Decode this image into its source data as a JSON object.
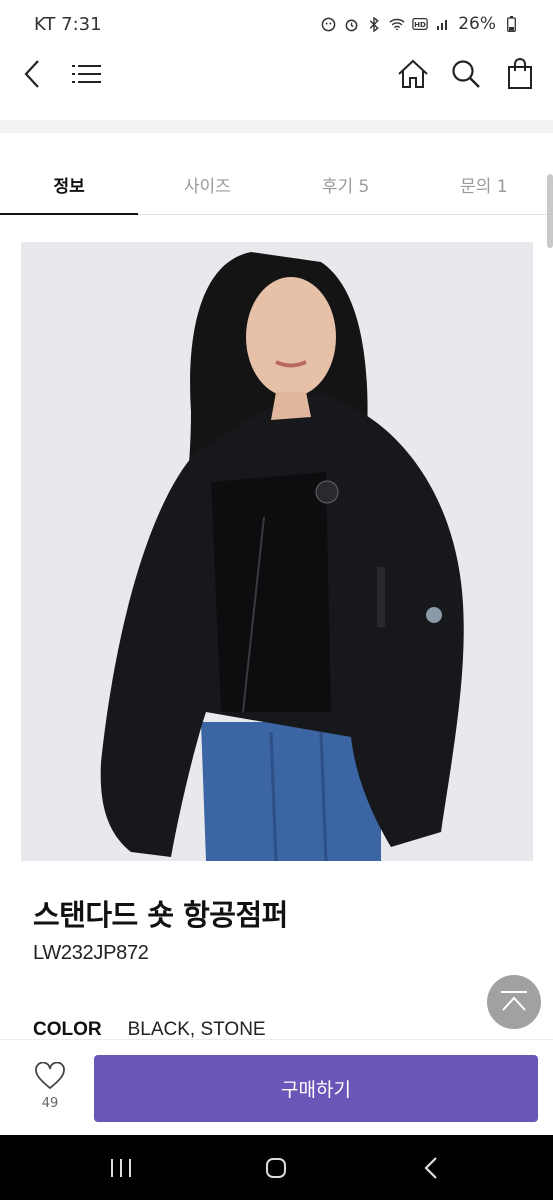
{
  "status": {
    "carrier_time": "KT 7:31",
    "battery": "26%",
    "icons": [
      "face-icon",
      "alarm-icon",
      "bluetooth-icon",
      "wifi-icon",
      "hd-icon",
      "signal-icon",
      "battery-icon"
    ]
  },
  "app_bar": {
    "icons": [
      "back-icon",
      "menu-icon",
      "home-icon",
      "search-icon",
      "shopping-bag-icon"
    ]
  },
  "tabs": [
    {
      "label": "정보",
      "active": true
    },
    {
      "label": "사이즈",
      "active": false
    },
    {
      "label": "후기 5",
      "active": false
    },
    {
      "label": "문의 1",
      "active": false
    }
  ],
  "product": {
    "image": "model wearing black cropped bomber jacket and blue jeans",
    "title": "스탠다드 숏 항공점퍼",
    "code": "LW232JP872",
    "color_label": "COLOR",
    "color_value": "BLACK, STONE"
  },
  "bottom_bar": {
    "wish_count": "49",
    "buy_label": "구매하기",
    "buy_color": "#6a56b9"
  },
  "system_nav": {
    "icons": [
      "recent-apps-icon",
      "home-button-icon",
      "back-button-icon"
    ]
  }
}
